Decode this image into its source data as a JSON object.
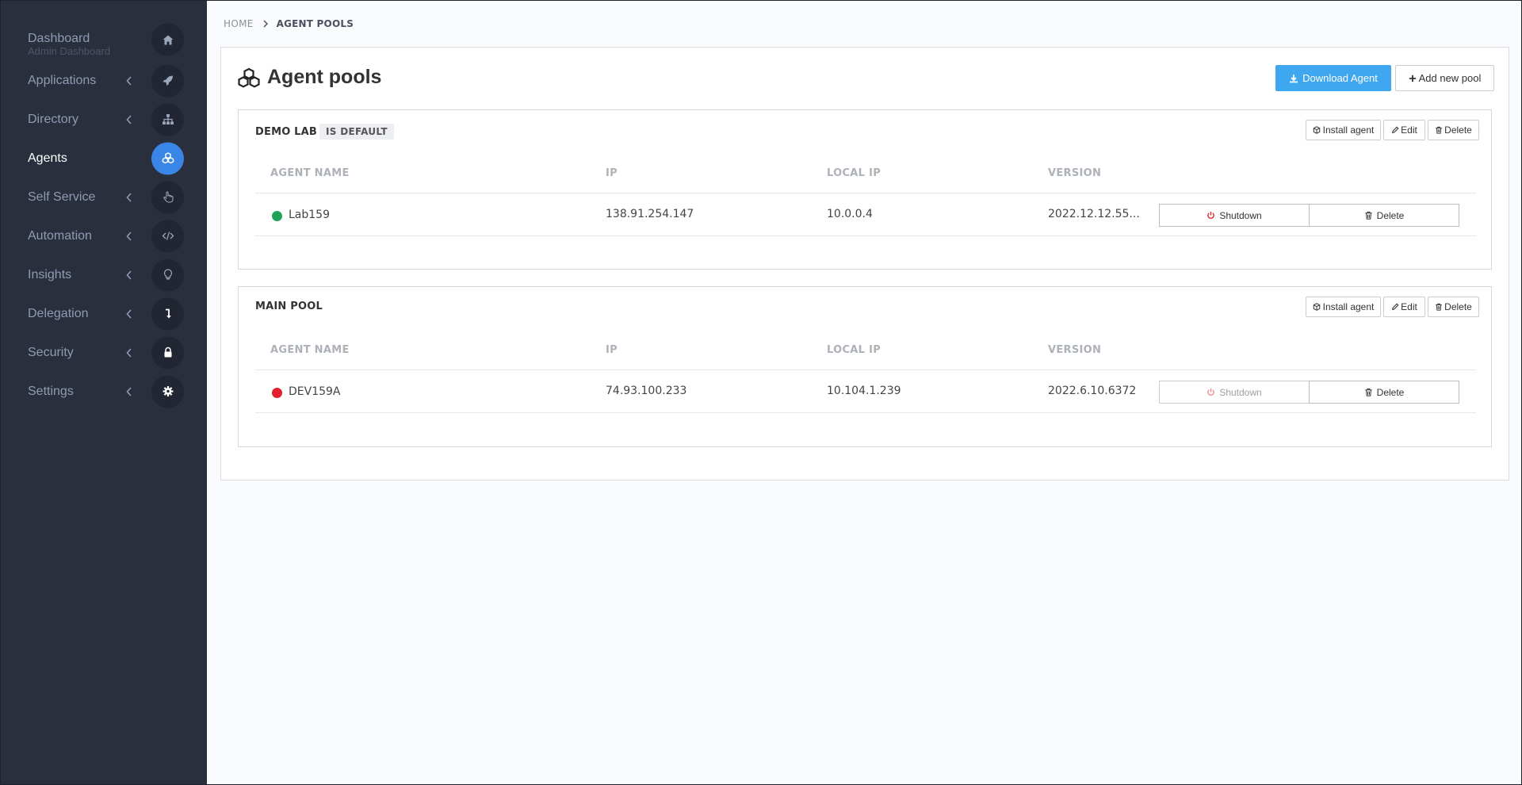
{
  "sidebar": {
    "items": [
      {
        "label": "Dashboard",
        "sublabel": "Admin Dashboard",
        "icon": "home-icon"
      },
      {
        "label": "Applications",
        "icon": "rocket-icon"
      },
      {
        "label": "Directory",
        "icon": "sitemap-icon"
      },
      {
        "label": "Agents",
        "icon": "agents-icon",
        "active": true
      },
      {
        "label": "Self Service",
        "icon": "hand-pointer-icon"
      },
      {
        "label": "Automation",
        "icon": "code-icon"
      },
      {
        "label": "Insights",
        "icon": "lightbulb-icon"
      },
      {
        "label": "Delegation",
        "icon": "level-down-icon"
      },
      {
        "label": "Security",
        "icon": "lock-icon"
      },
      {
        "label": "Settings",
        "icon": "gear-icon"
      }
    ]
  },
  "breadcrumb": {
    "home": "HOME",
    "current": "AGENT POOLS"
  },
  "page": {
    "title": "Agent pools",
    "download_label": "Download Agent",
    "add_pool_label": "Add new pool"
  },
  "table_headers": {
    "agent_name": "AGENT NAME",
    "ip": "IP",
    "local_ip": "LOCAL IP",
    "version": "VERSION"
  },
  "pool_actions": {
    "install": "Install agent",
    "edit": "Edit",
    "delete": "Delete"
  },
  "row_actions": {
    "shutdown": "Shutdown",
    "delete": "Delete"
  },
  "pools": [
    {
      "name": "DEMO LAB",
      "badge": "IS DEFAULT",
      "agents": [
        {
          "name": "Lab159",
          "ip": "138.91.254.147",
          "local_ip": "10.0.0.4",
          "version": "2022.12.12.55...",
          "status": "online"
        }
      ]
    },
    {
      "name": "MAIN POOL",
      "agents": [
        {
          "name": "DEV159A",
          "ip": "74.93.100.233",
          "local_ip": "10.104.1.239",
          "version": "2022.6.10.6372",
          "status": "offline"
        }
      ]
    }
  ],
  "colors": {
    "sidebar_bg": "#2a2f3d",
    "accent": "#3a86e6",
    "primary_button": "#3ea7ef",
    "online": "#1fa35b",
    "offline": "#e0202f",
    "shutdown_icon": "#e0202f"
  }
}
